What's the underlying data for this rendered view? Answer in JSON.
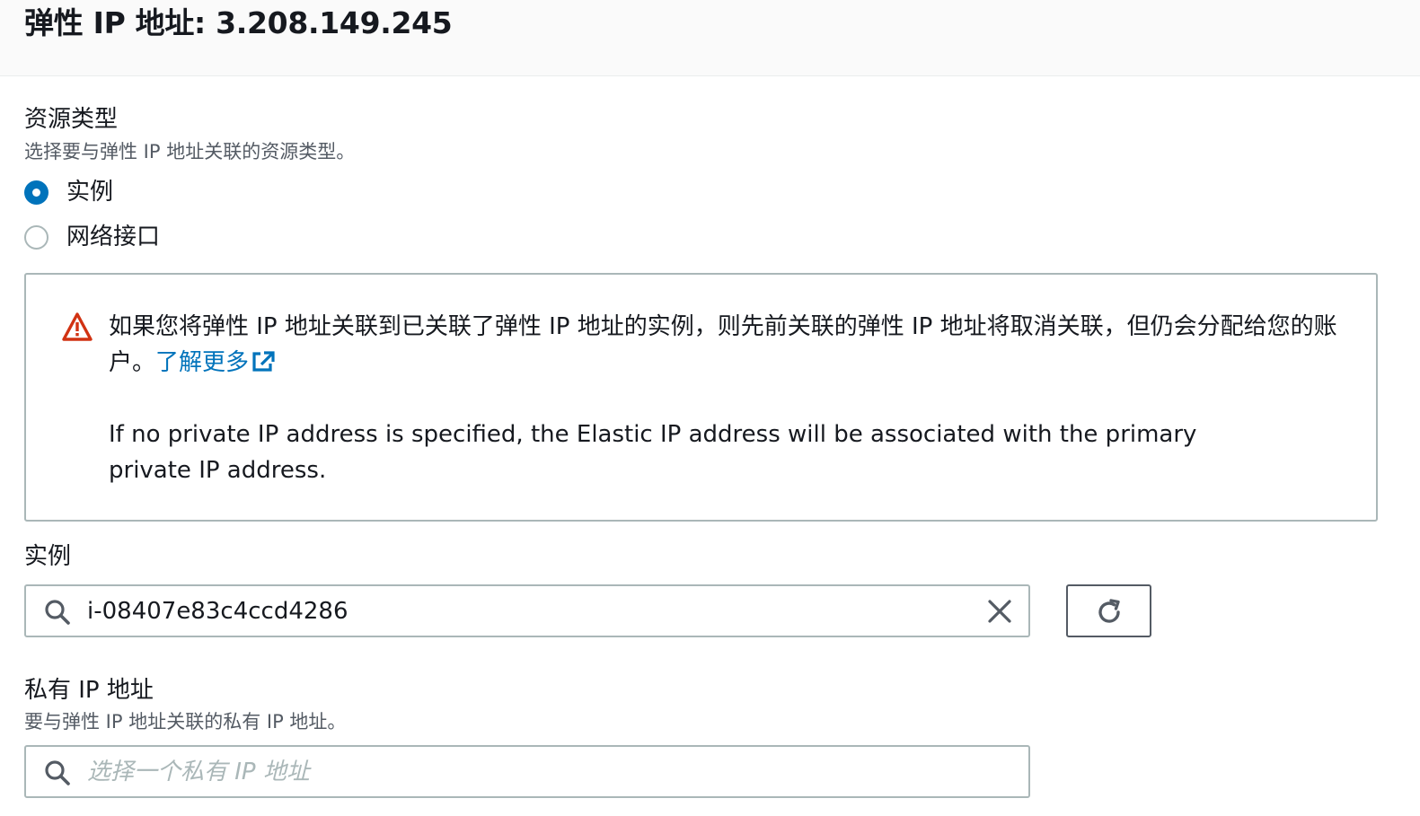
{
  "header": {
    "title": "弹性 IP 地址: 3.208.149.245"
  },
  "resource_type": {
    "label": "资源类型",
    "description": "选择要与弹性 IP 地址关联的资源类型。",
    "options": [
      {
        "label": "实例",
        "selected": true
      },
      {
        "label": "网络接口",
        "selected": false
      }
    ]
  },
  "alert": {
    "icon": "warning-icon",
    "message": "如果您将弹性 IP 地址关联到已关联了弹性 IP 地址的实例，则先前关联的弹性 IP 地址将取消关联，但仍会分配给您的账户。",
    "link_label": "了解更多",
    "note": "If no private IP address is specified, the Elastic IP address will be associated with the primary private IP address."
  },
  "instance": {
    "label": "实例",
    "value": "i-08407e83c4ccd4286"
  },
  "private_ip": {
    "label": "私有 IP 地址",
    "description": "要与弹性 IP 地址关联的私有 IP 地址。",
    "placeholder": "选择一个私有 IP 地址"
  },
  "colors": {
    "accent": "#0073bb",
    "warning": "#d13212",
    "border": "#aab7b8",
    "muted_text": "#545b64"
  }
}
